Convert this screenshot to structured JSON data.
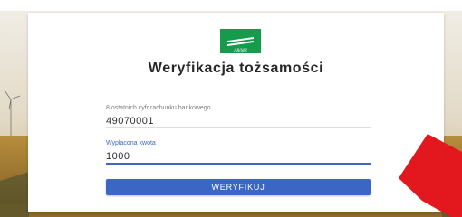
{
  "logo": {
    "text": "ARiMR",
    "icon": "arimr-logo-icon",
    "color": "#169a4c"
  },
  "title": "Weryfikacja tożsamości",
  "form": {
    "account": {
      "label": "8 ostatnich cyfr rachunku bankowego",
      "value": "49070001"
    },
    "amount": {
      "label": "Wypłacona kwota",
      "value": "1000"
    },
    "submit_label": "WERYFIKUJ"
  },
  "overlay": {
    "icon": "red-arrow-icon",
    "color": "#e3181e"
  },
  "colors": {
    "accent": "#3b67c4",
    "background_sky": "#e6dfd2",
    "background_field": "#c9a040"
  }
}
